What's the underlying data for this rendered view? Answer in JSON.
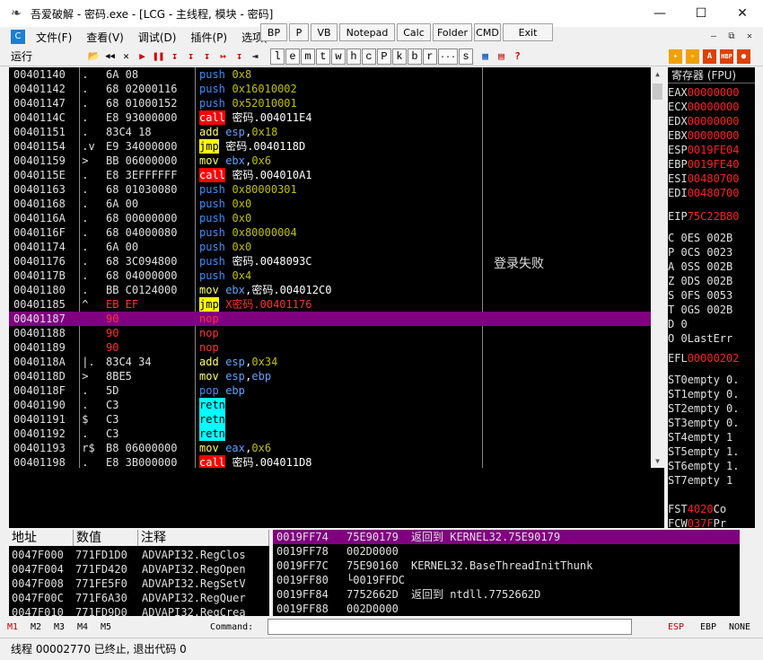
{
  "window": {
    "title": "吾爱破解 - 密码.exe - [LCG - 主线程, 模块 - 密码]",
    "minimize": "—",
    "maximize": "☐",
    "close": "✕"
  },
  "menu": {
    "logo": "C",
    "items": [
      "文件(F)",
      "查看(V)",
      "调试(D)",
      "插件(P)",
      "选项(T"
    ]
  },
  "plugins": [
    "BP",
    "P",
    "VB",
    "Notepad",
    "Calc",
    "Folder",
    "CMD",
    "Exit"
  ],
  "mdi": [
    "—",
    "⧉",
    "✕"
  ],
  "toolbar": {
    "status": "运行",
    "buttons": [
      "📂",
      "◀◀",
      "✕",
      "▶",
      "❚❚",
      "↧",
      "↧",
      "↧",
      "↦",
      "↧",
      "⇥"
    ],
    "letters": [
      "l",
      "e",
      "m",
      "t",
      "w",
      "h",
      "c",
      "P",
      "k",
      "b",
      "r",
      "...",
      "s"
    ]
  },
  "disasm": {
    "rows": [
      {
        "addr": "00401140",
        "mark": " .",
        "hex": "6A 08",
        "mn": "push",
        "ops": [
          {
            "t": "0x8",
            "c": "num"
          }
        ]
      },
      {
        "addr": "00401142",
        "mark": " .",
        "hex": "68 02000116",
        "mn": "push",
        "ops": [
          {
            "t": "0x16010002",
            "c": "num"
          }
        ]
      },
      {
        "addr": "00401147",
        "mark": " .",
        "hex": "68 01000152",
        "mn": "push",
        "ops": [
          {
            "t": "0x52010001",
            "c": "num"
          }
        ]
      },
      {
        "addr": "0040114C",
        "mark": " .",
        "hex": "E8 93000000",
        "mn": "call",
        "ops": [
          {
            "t": "密码.004011E4",
            "c": "txt"
          }
        ]
      },
      {
        "addr": "00401151",
        "mark": " .",
        "hex": "83C4 18",
        "mn": "add",
        "ops": [
          {
            "t": "esp",
            "c": "reg"
          },
          {
            "t": ",",
            "c": "txt"
          },
          {
            "t": "0x18",
            "c": "num"
          }
        ]
      },
      {
        "addr": "00401154",
        "mark": " .v",
        "hex": "E9 34000000",
        "mn": "jmp",
        "ops": [
          {
            "t": "密码.0040118D",
            "c": "txt"
          }
        ]
      },
      {
        "addr": "00401159",
        "mark": " >",
        "hex": "BB 06000000",
        "mn": "mov",
        "ops": [
          {
            "t": "ebx",
            "c": "reg"
          },
          {
            "t": ",",
            "c": "txt"
          },
          {
            "t": "0x6",
            "c": "num"
          }
        ]
      },
      {
        "addr": "0040115E",
        "mark": " .",
        "hex": "E8 3EFFFFFF",
        "mn": "call",
        "ops": [
          {
            "t": "密码.004010A1",
            "c": "txt"
          }
        ]
      },
      {
        "addr": "00401163",
        "mark": " .",
        "hex": "68 01030080",
        "mn": "push",
        "ops": [
          {
            "t": "0x80000301",
            "c": "num"
          }
        ]
      },
      {
        "addr": "00401168",
        "mark": " .",
        "hex": "6A 00",
        "mn": "push",
        "ops": [
          {
            "t": "0x0",
            "c": "num"
          }
        ]
      },
      {
        "addr": "0040116A",
        "mark": " .",
        "hex": "68 00000000",
        "mn": "push",
        "ops": [
          {
            "t": "0x0",
            "c": "num"
          }
        ]
      },
      {
        "addr": "0040116F",
        "mark": " .",
        "hex": "68 04000080",
        "mn": "push",
        "ops": [
          {
            "t": "0x80000004",
            "c": "num"
          }
        ]
      },
      {
        "addr": "00401174",
        "mark": " .",
        "hex": "6A 00",
        "mn": "push",
        "ops": [
          {
            "t": "0x0",
            "c": "num"
          }
        ]
      },
      {
        "addr": "00401176",
        "mark": " .",
        "hex": "68 3C094800",
        "mn": "push",
        "ops": [
          {
            "t": "密码.0048093C",
            "c": "txt"
          }
        ]
      },
      {
        "addr": "0040117B",
        "mark": " .",
        "hex": "68 04000000",
        "mn": "push",
        "ops": [
          {
            "t": "0x4",
            "c": "num"
          }
        ]
      },
      {
        "addr": "00401180",
        "mark": " .",
        "hex": "BB C0124000",
        "mn": "mov",
        "ops": [
          {
            "t": "ebx",
            "c": "reg"
          },
          {
            "t": ",",
            "c": "txt"
          },
          {
            "t": "密码.004012C0",
            "c": "txt"
          }
        ]
      },
      {
        "addr": "00401185",
        "mark": " ^",
        "hex": "EB EF",
        "mn": "jmp",
        "ops": [
          {
            "t": "X密码.00401176",
            "c": "red"
          }
        ],
        "hexred": true
      },
      {
        "addr": "00401187",
        "mark": "",
        "hex": "90",
        "mn": "nop",
        "ops": [],
        "sel": true,
        "hexred": true
      },
      {
        "addr": "00401188",
        "mark": "",
        "hex": "90",
        "mn": "nop",
        "ops": [],
        "hexred": true
      },
      {
        "addr": "00401189",
        "mark": "",
        "hex": "90",
        "mn": "nop",
        "ops": [],
        "hexred": true
      },
      {
        "addr": "0040118A",
        "mark": " |.",
        "hex": "83C4 34",
        "mn": "add",
        "ops": [
          {
            "t": "esp",
            "c": "reg"
          },
          {
            "t": ",",
            "c": "txt"
          },
          {
            "t": "0x34",
            "c": "num"
          }
        ]
      },
      {
        "addr": "0040118D",
        "mark": " >",
        "hex": "8BE5",
        "mn": "mov",
        "ops": [
          {
            "t": "esp",
            "c": "reg"
          },
          {
            "t": ",",
            "c": "txt"
          },
          {
            "t": "ebp",
            "c": "reg"
          }
        ]
      },
      {
        "addr": "0040118F",
        "mark": " .",
        "hex": "5D",
        "mn": "pop",
        "ops": [
          {
            "t": "ebp",
            "c": "reg"
          }
        ]
      },
      {
        "addr": "00401190",
        "mark": " .",
        "hex": "C3",
        "mn": "retn",
        "ops": []
      },
      {
        "addr": "00401191",
        "mark": " $",
        "hex": "C3",
        "mn": "retn",
        "ops": []
      },
      {
        "addr": "00401192",
        "mark": " .",
        "hex": "C3",
        "mn": "retn",
        "ops": []
      },
      {
        "addr": "00401193",
        "mark": " r$",
        "hex": "B8 06000000",
        "mn": "mov",
        "ops": [
          {
            "t": "eax",
            "c": "reg"
          },
          {
            "t": ",",
            "c": "txt"
          },
          {
            "t": "0x6",
            "c": "num"
          }
        ]
      },
      {
        "addr": "00401198",
        "mark": " .",
        "hex": "E8 3B000000",
        "mn": "call",
        "ops": [
          {
            "t": "密码.004011D8",
            "c": "txt"
          }
        ]
      }
    ],
    "comment": "登录失败"
  },
  "registers": {
    "header": "寄存器 (FPU)",
    "gprs": [
      [
        "EAX",
        "00000000"
      ],
      [
        "ECX",
        "00000000"
      ],
      [
        "EDX",
        "00000000"
      ],
      [
        "EBX",
        "00000000"
      ],
      [
        "ESP",
        "0019FE04"
      ],
      [
        "EBP",
        "0019FE40"
      ],
      [
        "ESI",
        "00480700"
      ],
      [
        "EDI",
        "00480700"
      ]
    ],
    "eip": [
      "EIP",
      "75C22B80"
    ],
    "flags": [
      [
        "C 0",
        "ES 002B"
      ],
      [
        "P 0",
        "CS 0023"
      ],
      [
        "A 0",
        "SS 002B"
      ],
      [
        "Z 0",
        "DS 002B"
      ],
      [
        "S 0",
        "FS 0053"
      ],
      [
        "T 0",
        "GS 002B"
      ],
      [
        "D 0",
        ""
      ],
      [
        "O 0",
        "LastErr"
      ]
    ],
    "efl": [
      "EFL",
      "00000202"
    ],
    "st": [
      [
        "ST0",
        "empty 0."
      ],
      [
        "ST1",
        "empty 0."
      ],
      [
        "ST2",
        "empty 0."
      ],
      [
        "ST3",
        "empty 0."
      ],
      [
        "ST4",
        "empty 1"
      ],
      [
        "ST5",
        "empty 1."
      ],
      [
        "ST6",
        "empty 1."
      ],
      [
        "ST7",
        "empty 1"
      ]
    ],
    "fst": [
      "FST",
      "4020",
      "Co"
    ],
    "fcw": [
      "FCW",
      "037F",
      "Pr"
    ]
  },
  "dump": {
    "headers": [
      "地址",
      "数值",
      "注释"
    ],
    "rows": [
      [
        "0047F000",
        "771FD1D0",
        "ADVAPI32.RegClos"
      ],
      [
        "0047F004",
        "771FD420",
        "ADVAPI32.RegOpen"
      ],
      [
        "0047F008",
        "771FE5F0",
        "ADVAPI32.RegSetV"
      ],
      [
        "0047F00C",
        "771F6A30",
        "ADVAPI32.RegQuer"
      ],
      [
        "0047F010",
        "771FD9D0",
        "ADVAPI32.RegCrea"
      ]
    ]
  },
  "stack": {
    "rows": [
      [
        "0019FF74",
        "75E90179",
        "返回到 KERNEL32.75E90179"
      ],
      [
        "0019FF78",
        "002D0000",
        ""
      ],
      [
        "0019FF7C",
        "75E90160",
        "KERNEL32.BaseThreadInitThunk"
      ],
      [
        "0019FF80",
        "└0019FFDC",
        ""
      ],
      [
        "0019FF84",
        "7752662D",
        "返回到 ntdll.7752662D"
      ],
      [
        "0019FF88",
        "002D0000",
        ""
      ]
    ]
  },
  "cmdbar": {
    "markers": [
      "M1",
      "M2",
      "M3",
      "M4",
      "M5"
    ],
    "label": "Command:",
    "right": [
      "ESP",
      "EBP",
      "NONE"
    ]
  },
  "statusbar": {
    "text": "线程 00002770 已终止, 退出代码 0"
  },
  "colors": {
    "selection": "#800080",
    "call": "#ff0000",
    "jmp": "#ffff00",
    "retn": "#00ffff"
  }
}
